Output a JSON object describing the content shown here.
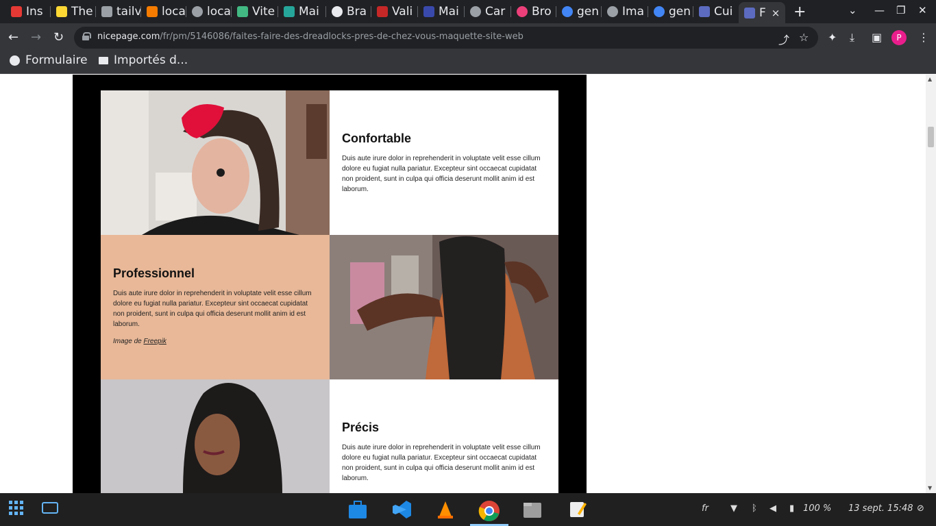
{
  "browser": {
    "tabs": [
      {
        "label": "Ins",
        "color": "#e53935"
      },
      {
        "label": "The",
        "color": "#fdd835"
      },
      {
        "label": "tailv",
        "color": "#9aa0a6"
      },
      {
        "label": "loca",
        "color": "#f57c00"
      },
      {
        "label": "loca",
        "color": "#9aa0a6"
      },
      {
        "label": "Vite",
        "color": "#42b883"
      },
      {
        "label": "Mai",
        "color": "#26a69a"
      },
      {
        "label": "Bra",
        "color": "#e8eaed"
      },
      {
        "label": "Vali",
        "color": "#c62828"
      },
      {
        "label": "Mai",
        "color": "#3949ab"
      },
      {
        "label": "Car",
        "color": "#9aa0a6"
      },
      {
        "label": "Bro",
        "color": "#ec407a"
      },
      {
        "label": "gen",
        "color": "#4285f4"
      },
      {
        "label": "Ima",
        "color": "#9aa0a6"
      },
      {
        "label": "gen",
        "color": "#4285f4"
      },
      {
        "label": "Cui",
        "color": "#5c6bc0"
      },
      {
        "label": "F",
        "color": "#5c6bc0"
      }
    ],
    "active_tab_close": "×",
    "new_tab": "+",
    "url_host": "nicepage.com",
    "url_path": "/fr/pm/5146086/faites-faire-des-dreadlocks-pres-de-chez-vous-maquette-site-web",
    "profile_initial": "P",
    "bookmarks": [
      "Formulaire",
      "Importés d..."
    ]
  },
  "page": {
    "features": [
      {
        "title": "Confortable",
        "body": "Duis aute irure dolor in reprehenderit in voluptate velit esse cillum dolore eu fugiat nulla pariatur. Excepteur sint occaecat cupidatat non proident, sunt in culpa qui officia deserunt mollit anim id est laborum."
      },
      {
        "title": "Professionnel",
        "body": "Duis aute irure dolor in reprehenderit in voluptate velit esse cillum dolore eu fugiat nulla pariatur. Excepteur sint occaecat cupidatat non proident, sunt in culpa qui officia deserunt mollit anim id est laborum.",
        "credit_prefix": "Image de ",
        "credit_link": "Freepik"
      },
      {
        "title": "Précis",
        "body": "Duis aute irure dolor in reprehenderit in voluptate velit esse cillum dolore eu fugiat nulla pariatur. Excepteur sint occaecat cupidatat non proident, sunt in culpa qui officia deserunt mollit anim id est laborum."
      }
    ],
    "colors": {
      "peach": "#e8b898",
      "white": "#ffffff",
      "frame": "#000000"
    }
  },
  "taskbar": {
    "language": "fr",
    "battery": "100 %",
    "datetime": "13 sept. 15:48"
  }
}
